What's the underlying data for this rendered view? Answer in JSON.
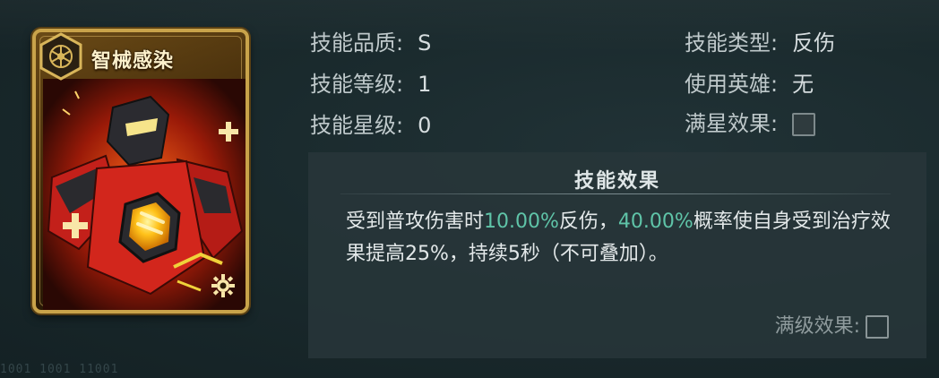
{
  "card": {
    "title": "智械感染",
    "emblem_icon": "hex-gear-emblem-icon",
    "art_icon": "mech-robot-art",
    "corner_icon": "cog-icon"
  },
  "info": {
    "quality_label": "技能品质:",
    "quality_value": "S",
    "level_label": "技能等级:",
    "level_value": "1",
    "star_label": "技能星级:",
    "star_value": "0",
    "type_label": "技能类型:",
    "type_value": "反伤",
    "hero_label": "使用英雄:",
    "hero_value": "无",
    "full_star_label": "满星效果:"
  },
  "effect": {
    "title": "技能效果",
    "desc_1": "受到普攻伤害时",
    "desc_hl_1": "10.00%",
    "desc_2": "反伤，",
    "desc_hl_2": "40.00%",
    "desc_3": "概率使自身受到治疗效果提高25%，持续5秒（不可叠加）。",
    "max_label": "满级效果:"
  },
  "footer_text": "1001 1001 11001",
  "colors": {
    "highlight": "#5fc4a8",
    "card_gold": "#c9a34a",
    "background": "#1a2a2d"
  }
}
